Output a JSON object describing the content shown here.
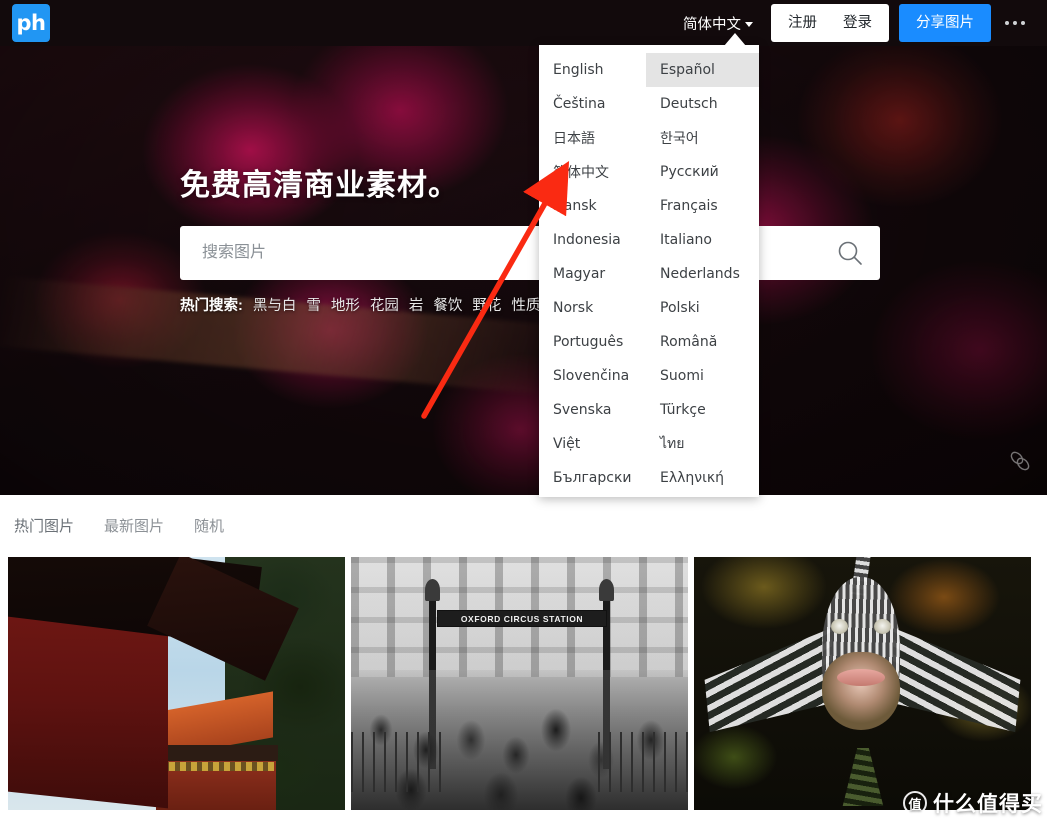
{
  "site": {
    "logo_text": "ph",
    "logo_color": "#2196f3"
  },
  "topnav": {
    "language_selector": "简体中文",
    "register_label": "注册",
    "login_label": "登录",
    "share_label": "分享图片",
    "more_label": "更多"
  },
  "language_dropdown": {
    "selected_highlight": "Español",
    "items": [
      "English",
      "Español",
      "Čeština",
      "Deutsch",
      "日本語",
      "한국어",
      "简体中文",
      "Русский",
      "Dansk",
      "Français",
      "Indonesia",
      "Italiano",
      "Magyar",
      "Nederlands",
      "Norsk",
      "Polski",
      "Português",
      "Română",
      "Slovenčina",
      "Suomi",
      "Svenska",
      "Türkçe",
      "Việt",
      "ไทย",
      "Български",
      "Ελληνική"
    ]
  },
  "hero": {
    "title": "免费高清商业素材。",
    "search_placeholder": "搜索图片",
    "search_value": "",
    "popular_label": "热门搜索:",
    "popular_tags": [
      "黑与白",
      "雪",
      "地形",
      "花园",
      "岩",
      "餐饮",
      "野花",
      "性质"
    ]
  },
  "tabs": [
    {
      "label": "热门图片",
      "active": true
    },
    {
      "label": "最新图片",
      "active": false
    },
    {
      "label": "随机",
      "active": false
    }
  ],
  "gallery": {
    "thumbnails": [
      {
        "alt": "红墙宫殿建筑",
        "sign_text": ""
      },
      {
        "alt": "牛津广场地铁站人群黑白照",
        "sign_text": "OXFORD CIRCUS STATION"
      },
      {
        "alt": "狮子鱼特写",
        "sign_text": ""
      }
    ]
  },
  "watermark": {
    "badge": "值",
    "text": "什么值得买"
  },
  "annotation": {
    "arrow_color": "#fa2a12",
    "points_to": "简体中文"
  }
}
